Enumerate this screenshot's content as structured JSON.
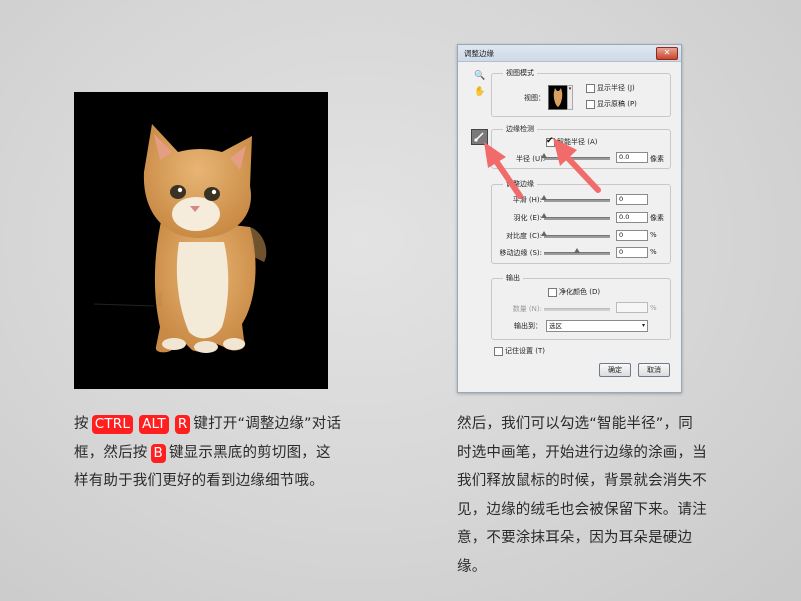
{
  "left_caption": {
    "seg1": "按",
    "key_ctrl": "CTRL",
    "key_alt": "ALT",
    "key_r": "R",
    "seg2": "键打开“调整边缘”对话框，然后按",
    "key_b": "B",
    "seg3": "键显示黑底的剪切图，这样有助于我们更好的看到边缘细节哦。"
  },
  "right_caption": "然后，我们可以勾选“智能半径”，同时选中画笔，开始进行边缘的涂画，当我们释放鼠标的时候，背景就会消失不见，边缘的绒毛也会被保留下来。请注意，不要涂抹耳朵，因为耳朵是硬边缘。",
  "dialog": {
    "title": "调整边缘",
    "close_glyph": "✕",
    "tools": {
      "zoom": "🔍",
      "hand": "✋"
    },
    "view_mode": {
      "group_label": "视图模式",
      "view_label": "视图：",
      "show_radius": "显示半径 (J)",
      "show_original": "显示原稿 (P)"
    },
    "edge_detection": {
      "group_label": "边缘检测",
      "smart_radius": "智能半径 (A)",
      "radius_label": "半径 (U):",
      "radius_value": "0.0",
      "radius_unit": "像素",
      "radius_level": 0
    },
    "adjust_edge": {
      "group_label": "调整边缘",
      "smooth_label": "平滑 (H):",
      "smooth_value": "0",
      "smooth_level": 0,
      "feather_label": "羽化 (E):",
      "feather_value": "0.0",
      "feather_unit": "像素",
      "feather_level": 0,
      "contrast_label": "对比度 (C):",
      "contrast_value": "0",
      "contrast_unit": "%",
      "contrast_level": 0,
      "shift_label": "移动边缘 (S):",
      "shift_value": "0",
      "shift_unit": "%",
      "shift_level": 0.5
    },
    "output": {
      "group_label": "输出",
      "decontaminate": "净化颜色 (D)",
      "amount_label": "数量 (N):",
      "amount_unit": "%",
      "output_to_label": "输出到：",
      "output_to_value": "选区"
    },
    "remember": "记住设置 (T)",
    "ok": "确定",
    "cancel": "取消"
  },
  "colors": {
    "key_highlight": "#ff1f1f",
    "arrow": "#f26b6b"
  }
}
